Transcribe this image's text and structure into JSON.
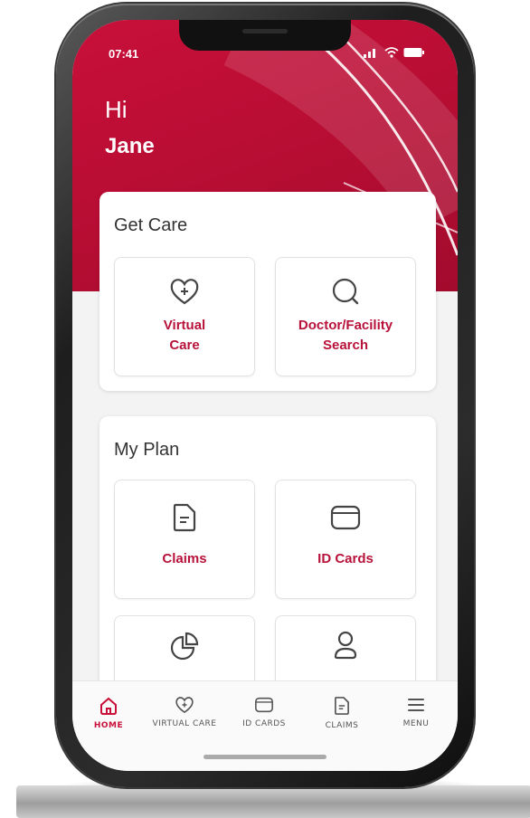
{
  "status_bar": {
    "time": "07:41"
  },
  "greeting": {
    "hi": "Hi",
    "name": "Jane"
  },
  "get_care": {
    "title": "Get Care",
    "tiles": [
      {
        "label": "Virtual\nCare",
        "icon": "heart-plus-icon"
      },
      {
        "label": "Doctor/Facility\nSearch",
        "icon": "search-icon"
      }
    ]
  },
  "my_plan": {
    "title": "My Plan",
    "tiles": [
      {
        "label": "Claims",
        "icon": "document-icon"
      },
      {
        "label": "ID Cards",
        "icon": "id-card-icon"
      },
      {
        "label": "",
        "icon": "pie-chart-icon"
      },
      {
        "label": "",
        "icon": "user-icon"
      }
    ]
  },
  "bottom_nav": {
    "items": [
      {
        "label": "HOME",
        "icon": "home-icon",
        "active": true
      },
      {
        "label": "VIRTUAL CARE",
        "icon": "heart-plus-icon",
        "active": false
      },
      {
        "label": "ID CARDS",
        "icon": "id-card-icon",
        "active": false
      },
      {
        "label": "CLAIMS",
        "icon": "document-icon",
        "active": false
      },
      {
        "label": "MENU",
        "icon": "menu-icon",
        "active": false
      }
    ]
  },
  "colors": {
    "brand": "#c8103a",
    "text": "#333333"
  }
}
